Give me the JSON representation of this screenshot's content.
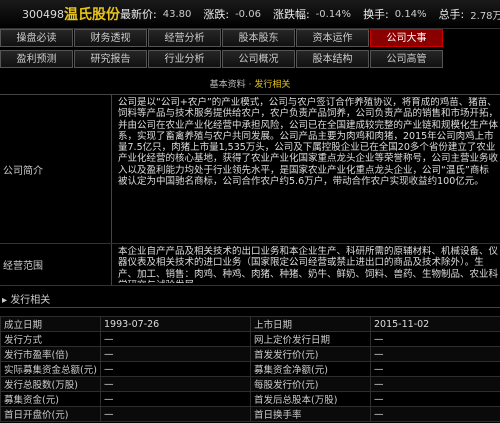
{
  "quote": {
    "code": "300498",
    "name": "温氏股份",
    "items": [
      {
        "label": "最新价:",
        "value": "43.80"
      },
      {
        "label": "涨跌:",
        "value": "-0.06"
      },
      {
        "label": "涨跌幅:",
        "value": "-0.14%"
      },
      {
        "label": "换手:",
        "value": "0.14%"
      },
      {
        "label": "总手:",
        "value": "2.78万"
      }
    ]
  },
  "nav": {
    "row1": [
      "操盘必读",
      "财务透视",
      "经营分析",
      "股本股东",
      "资本运作",
      "公司大事"
    ],
    "row2": [
      "盈利预测",
      "研究报告",
      "行业分析",
      "公司概况",
      "股本结构",
      "公司高管"
    ],
    "active": "公司大事"
  },
  "breadcrumb": {
    "prefix": "基本资料",
    "sep": "·",
    "current": "发行相关"
  },
  "profile": {
    "intro_label": "公司简介",
    "intro_text": "公司是以“公司+农户”的产业模式，公司与农户签订合作养殖协议，将育成的鸡苗、猪苗、饲料等产品与技术服务提供给农户，农户负责产品饲养，公司负责产品的销售和市场开拓，并由公司在农业产业化经营中承担风险，公司已在全国建成较完整的产业链和规模化生产体系，实现了畜禽养殖与农户共同发展。公司产品主要为肉鸡和肉猪，2015年公司肉鸡上市量7.5亿只，肉猪上市量1,535万头，公司及下属控股企业已在全国20多个省份建立了农业产业化经营的核心基地，获得了农业产业化国家重点龙头企业等荣誉称号，公司主营业务收入以及盈利能力均处于行业领先水平，是国家农业产业化重点龙头企业，公司“温氏”商标被认定为中国驰名商标，公司合作农户约5.6万户，带动合作农户实现收益约100亿元。",
    "scope_label": "经营范围",
    "scope_text": "本企业自产产品及相关技术的出口业务和本企业生产、科研所需的原辅材料、机械设备、仪器仪表及相关技术的进口业务（国家限定公司经营或禁止进出口的商品及技术除外）。生产、加工、销售：肉鸡、种鸡、肉猪、种猪、奶牛、鲜奶、饲料、兽药、生物制品、农业科学研究与试验发展。"
  },
  "issue": {
    "title": "发行相关",
    "rows": [
      [
        "成立日期",
        "1993-07-26",
        "上市日期",
        "2015-11-02"
      ],
      [
        "发行方式",
        "—",
        "网上定价发行日期",
        "—"
      ],
      [
        "发行市盈率(倍)",
        "—",
        "首发发行价(元)",
        "—"
      ],
      [
        "实际募集资金总额(元)",
        "—",
        "募集资金净额(元)",
        "—"
      ],
      [
        "发行总股数(万股)",
        "—",
        "每股发行价(元)",
        "—"
      ],
      [
        "募集资金(元)",
        "—",
        "首发后总股本(万股)",
        "—"
      ],
      [
        "首日开盘价(元)",
        "—",
        "首日换手率",
        "—"
      ]
    ]
  }
}
